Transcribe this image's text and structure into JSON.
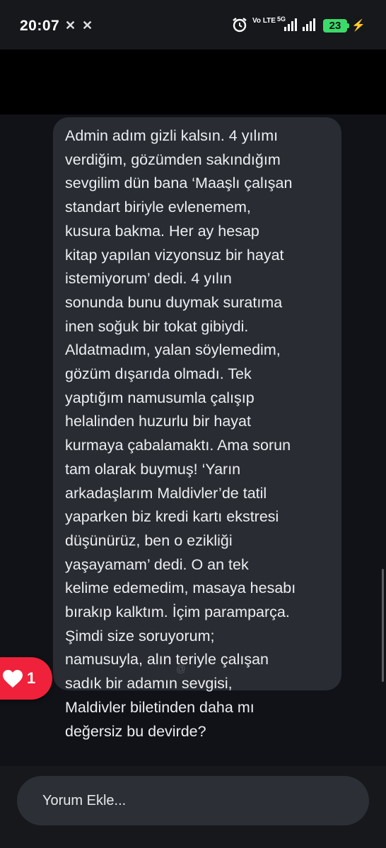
{
  "status_bar": {
    "time": "20:07",
    "notification_icons": [
      "x-icon",
      "x-icon"
    ],
    "volte_label": "Vo LTE",
    "network_label": "5G",
    "battery_level": "23"
  },
  "message": {
    "text": "Admin adım gizli kalsın. 4 yılımı\nverdiğim, gözümden sakındığım\nsevgilim dün bana ‘Maaşlı çalışan\nstandart biriyle evlenemem,\nkusura bakma. Her ay hesap\nkitap yapılan vizyonsuz bir hayat\nistemiyorum’ dedi. 4 yılın\nsonunda bunu duymak suratıma\ninen soğuk bir tokat gibiydi.\nAldatmadım, yalan söylemedim,\ngözüm dışarıda olmadı. Tek\nyaptığım namusumla çalışıp\nhelalinden huzurlu bir hayat\nkurmaya çabalamaktı. Ama sorun\ntam olarak buymuş! ‘Yarın\narkadaşlarım Maldivler’de tatil\nyaparken biz kredi kartı ekstresi\ndüşünürüz, ben o ezikliği\nyaşayamam’ dedi. O an tek\nkelime edemedim, masaya hesabı\nbırakıp kalktım. İçim paramparça.\nŞimdi size soruyorum;\nnamusuyla, alın teriyle çalışan\nsadık bir adamın sevgisi,\nMaldivler biletinden daha mı\ndeğersiz bu devirde?"
  },
  "like": {
    "count": "1",
    "icon": "heart-icon",
    "color": "#f0213a"
  },
  "comment_input": {
    "placeholder": "Yorum Ekle..."
  },
  "colors": {
    "bubble": "#292c33",
    "battery": "#3cd96b"
  }
}
